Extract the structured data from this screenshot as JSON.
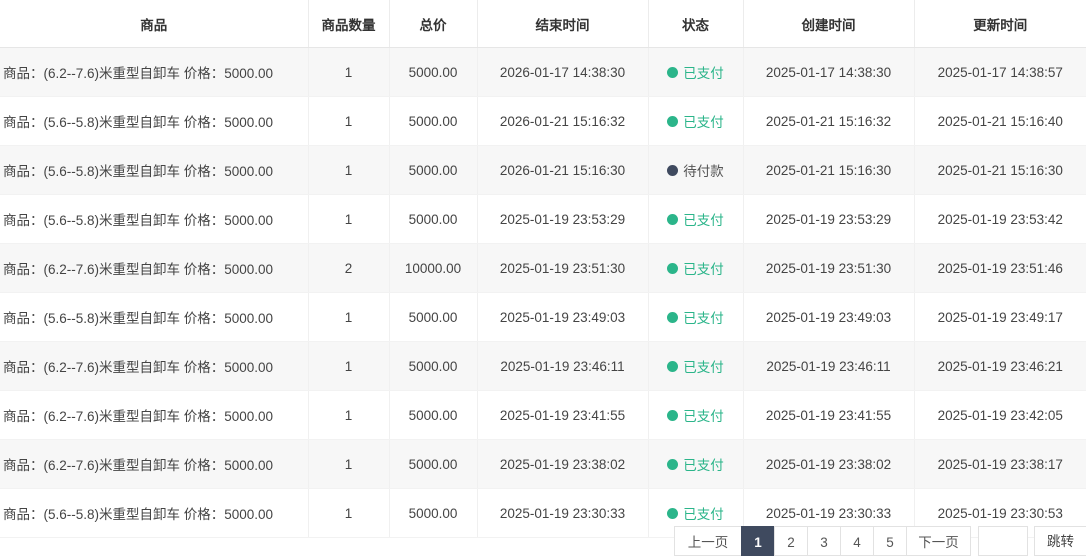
{
  "columns": [
    "商品",
    "商品数量",
    "总价",
    "结束时间",
    "状态",
    "创建时间",
    "更新时间"
  ],
  "colors": {
    "paid": "#2bb58a",
    "pending": "#3f4a5f",
    "active_page": "#3f4a5f"
  },
  "rows": [
    {
      "product": "商品：(6.2--7.6)米重型自卸车 价格：5000.00",
      "qty": "1",
      "total": "5000.00",
      "end": "2026-01-17 14:38:30",
      "status": "已支付",
      "status_type": "paid",
      "created": "2025-01-17 14:38:30",
      "updated": "2025-01-17 14:38:57"
    },
    {
      "product": "商品：(5.6--5.8)米重型自卸车 价格：5000.00",
      "qty": "1",
      "total": "5000.00",
      "end": "2026-01-21 15:16:32",
      "status": "已支付",
      "status_type": "paid",
      "created": "2025-01-21 15:16:32",
      "updated": "2025-01-21 15:16:40"
    },
    {
      "product": "商品：(5.6--5.8)米重型自卸车 价格：5000.00",
      "qty": "1",
      "total": "5000.00",
      "end": "2026-01-21 15:16:30",
      "status": "待付款",
      "status_type": "pending",
      "created": "2025-01-21 15:16:30",
      "updated": "2025-01-21 15:16:30"
    },
    {
      "product": "商品：(5.6--5.8)米重型自卸车 价格：5000.00",
      "qty": "1",
      "total": "5000.00",
      "end": "2025-01-19 23:53:29",
      "status": "已支付",
      "status_type": "paid",
      "created": "2025-01-19 23:53:29",
      "updated": "2025-01-19 23:53:42"
    },
    {
      "product": "商品：(6.2--7.6)米重型自卸车 价格：5000.00",
      "qty": "2",
      "total": "10000.00",
      "end": "2025-01-19 23:51:30",
      "status": "已支付",
      "status_type": "paid",
      "created": "2025-01-19 23:51:30",
      "updated": "2025-01-19 23:51:46"
    },
    {
      "product": "商品：(5.6--5.8)米重型自卸车 价格：5000.00",
      "qty": "1",
      "total": "5000.00",
      "end": "2025-01-19 23:49:03",
      "status": "已支付",
      "status_type": "paid",
      "created": "2025-01-19 23:49:03",
      "updated": "2025-01-19 23:49:17"
    },
    {
      "product": "商品：(6.2--7.6)米重型自卸车 价格：5000.00",
      "qty": "1",
      "total": "5000.00",
      "end": "2025-01-19 23:46:11",
      "status": "已支付",
      "status_type": "paid",
      "created": "2025-01-19 23:46:11",
      "updated": "2025-01-19 23:46:21"
    },
    {
      "product": "商品：(6.2--7.6)米重型自卸车 价格：5000.00",
      "qty": "1",
      "total": "5000.00",
      "end": "2025-01-19 23:41:55",
      "status": "已支付",
      "status_type": "paid",
      "created": "2025-01-19 23:41:55",
      "updated": "2025-01-19 23:42:05"
    },
    {
      "product": "商品：(6.2--7.6)米重型自卸车 价格：5000.00",
      "qty": "1",
      "total": "5000.00",
      "end": "2025-01-19 23:38:02",
      "status": "已支付",
      "status_type": "paid",
      "created": "2025-01-19 23:38:02",
      "updated": "2025-01-19 23:38:17"
    },
    {
      "product": "商品：(5.6--5.8)米重型自卸车 价格：5000.00",
      "qty": "1",
      "total": "5000.00",
      "end": "2025-01-19 23:30:33",
      "status": "已支付",
      "status_type": "paid",
      "created": "2025-01-19 23:30:33",
      "updated": "2025-01-19 23:30:53"
    }
  ],
  "pagination": {
    "prev_label": "上一页",
    "next_label": "下一页",
    "pages": [
      "1",
      "2",
      "3",
      "4",
      "5"
    ],
    "current_page": "1",
    "goto_value": "",
    "goto_label": "跳转"
  }
}
